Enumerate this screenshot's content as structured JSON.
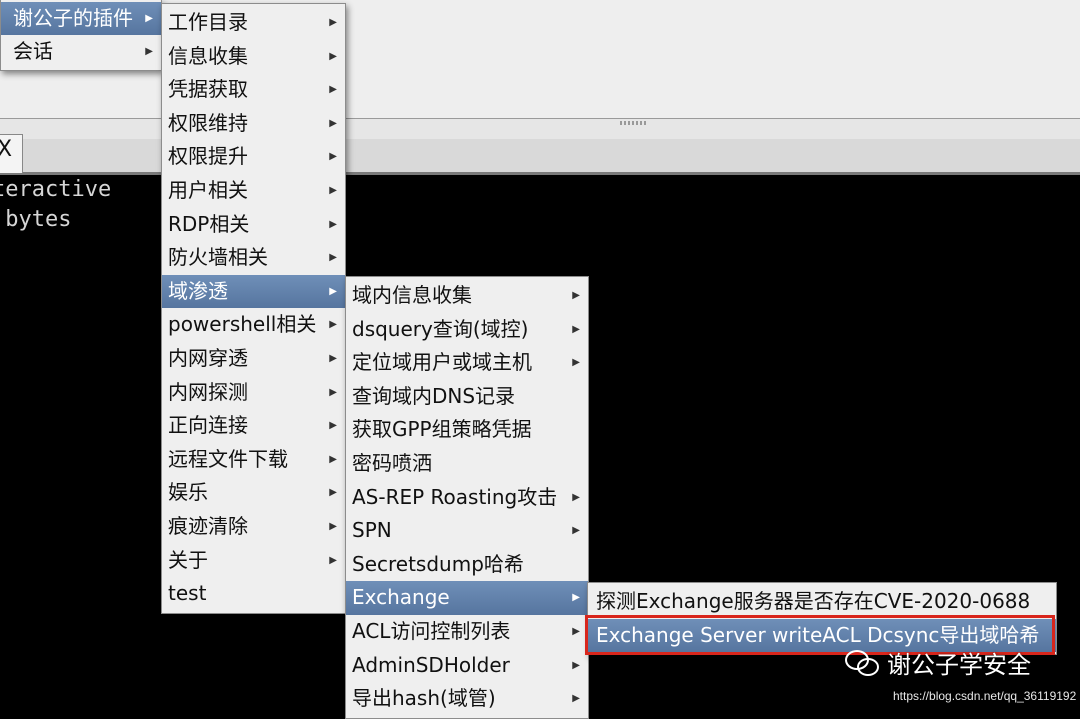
{
  "menubar": {
    "items": [
      {
        "label": "谢公子的插件",
        "active": true
      },
      {
        "label": "会话",
        "active": false
      }
    ]
  },
  "tab": {
    "close_glyph": "X"
  },
  "console": {
    "lines": [
      "teractive",
      " bytes"
    ]
  },
  "submenu_plugins": {
    "items": [
      {
        "label": "工作目录"
      },
      {
        "label": "信息收集"
      },
      {
        "label": "凭据获取"
      },
      {
        "label": "权限维持"
      },
      {
        "label": "权限提升"
      },
      {
        "label": "用户相关"
      },
      {
        "label": "RDP相关"
      },
      {
        "label": "防火墙相关"
      },
      {
        "label": "域渗透",
        "active": true
      },
      {
        "label": "powershell相关"
      },
      {
        "label": "内网穿透"
      },
      {
        "label": "内网探测"
      },
      {
        "label": "正向连接"
      },
      {
        "label": "远程文件下载"
      },
      {
        "label": "娱乐"
      },
      {
        "label": "痕迹清除"
      },
      {
        "label": "关于"
      },
      {
        "label": "test"
      }
    ]
  },
  "submenu_domain": {
    "items": [
      {
        "label": "域内信息收集"
      },
      {
        "label": "dsquery查询(域控)"
      },
      {
        "label": "定位域用户或域主机"
      },
      {
        "label": "查询域内DNS记录"
      },
      {
        "label": "获取GPP组策略凭据"
      },
      {
        "label": "密码喷洒"
      },
      {
        "label": "AS-REP Roasting攻击"
      },
      {
        "label": "SPN"
      },
      {
        "label": "Secretsdump哈希"
      },
      {
        "label": "Exchange",
        "active": true
      },
      {
        "label": "ACL访问控制列表"
      },
      {
        "label": "AdminSDHolder"
      },
      {
        "label": "导出hash(域管)"
      }
    ]
  },
  "submenu_exchange": {
    "items": [
      {
        "label": "探测Exchange服务器是否存在CVE-2020-0688"
      },
      {
        "label": "Exchange Server writeACL Dcsync导出域哈希",
        "active": true
      }
    ]
  },
  "watermark": {
    "text": "谢公子学安全",
    "url": "https://blog.csdn.net/qq_36119192"
  }
}
